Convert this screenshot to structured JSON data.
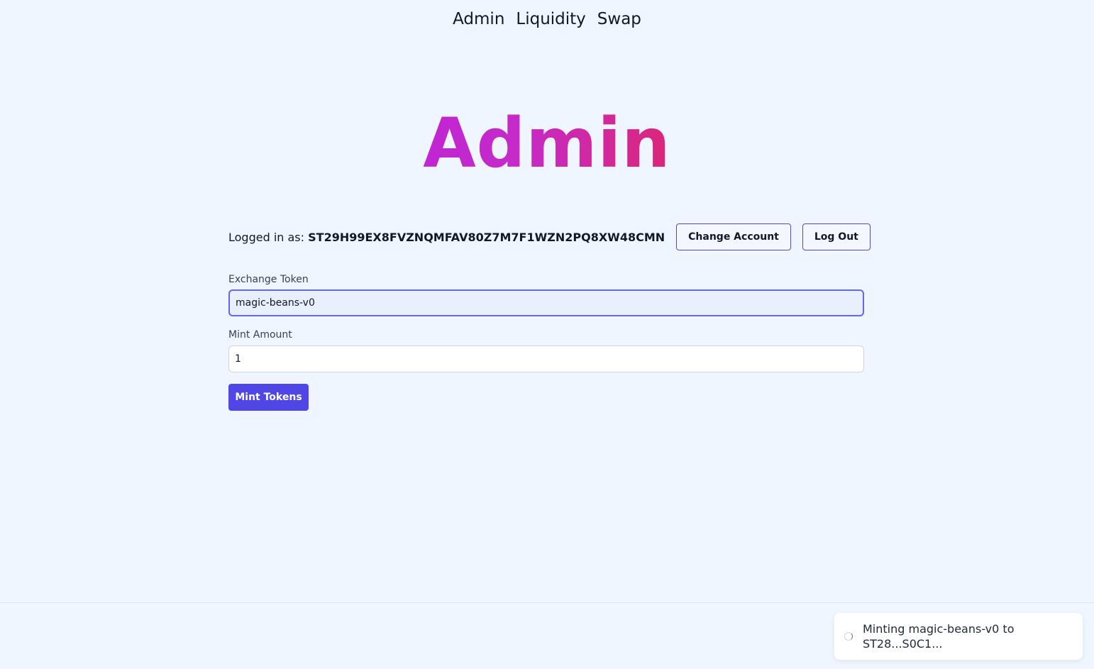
{
  "nav": {
    "items": [
      {
        "label": "Admin"
      },
      {
        "label": "Liquidity"
      },
      {
        "label": "Swap"
      }
    ]
  },
  "page_title": "Admin",
  "account": {
    "label": "Logged in as:",
    "address": "ST29H99EX8FVZNQMFAV80Z7M7F1WZN2PQ8XW48CMN",
    "change_button": "Change Account",
    "logout_button": "Log Out"
  },
  "form": {
    "exchange_token": {
      "label": "Exchange Token",
      "value": "magic-beans-v0"
    },
    "mint_amount": {
      "label": "Mint Amount",
      "value": "1"
    },
    "submit_label": "Mint Tokens"
  },
  "toast": {
    "message": "Minting magic-beans-v0 to ST28...S0C1..."
  },
  "colors": {
    "background": "#eff6ff",
    "accent": "#4f46e5",
    "title_gradient_start": "#c026d3",
    "title_gradient_end": "#db2777"
  }
}
